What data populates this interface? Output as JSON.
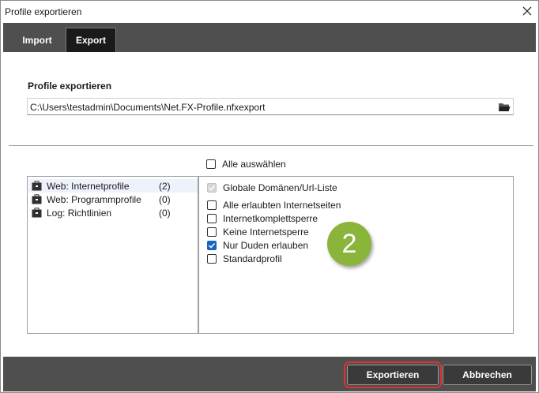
{
  "window": {
    "title": "Profile exportieren"
  },
  "tabs": [
    {
      "label": "Import"
    },
    {
      "label": "Export"
    }
  ],
  "export_section": {
    "label": "Profile exportieren",
    "path_value": "C:\\Users\\testadmin\\Documents\\Net.FX-Profile.nfxexport"
  },
  "select_all": {
    "label": "Alle auswählen",
    "checked": false
  },
  "categories": [
    {
      "name": "Web: Internetprofile",
      "count": "(2)"
    },
    {
      "name": "Web: Programmprofile",
      "count": "(0)"
    },
    {
      "name": "Log: Richtlinien",
      "count": "(0)"
    }
  ],
  "profiles": [
    {
      "label": "Globale Domänen/Url-Liste",
      "checked": true,
      "disabled": true
    },
    {
      "label": "Alle erlaubten Internetseiten",
      "checked": false
    },
    {
      "label": "Internetkomplettsperre",
      "checked": false
    },
    {
      "label": "Keine Internetsperre",
      "checked": false
    },
    {
      "label": "Nur Duden erlauben",
      "checked": true
    },
    {
      "label": "Standardprofil",
      "checked": false
    }
  ],
  "step_badge": "2",
  "buttons": {
    "export": "Exportieren",
    "cancel": "Abbrechen"
  },
  "colors": {
    "accent": "#1565c0",
    "badge": "#8ab43a",
    "highlight": "#e03030",
    "bar": "#4f4f4f"
  }
}
